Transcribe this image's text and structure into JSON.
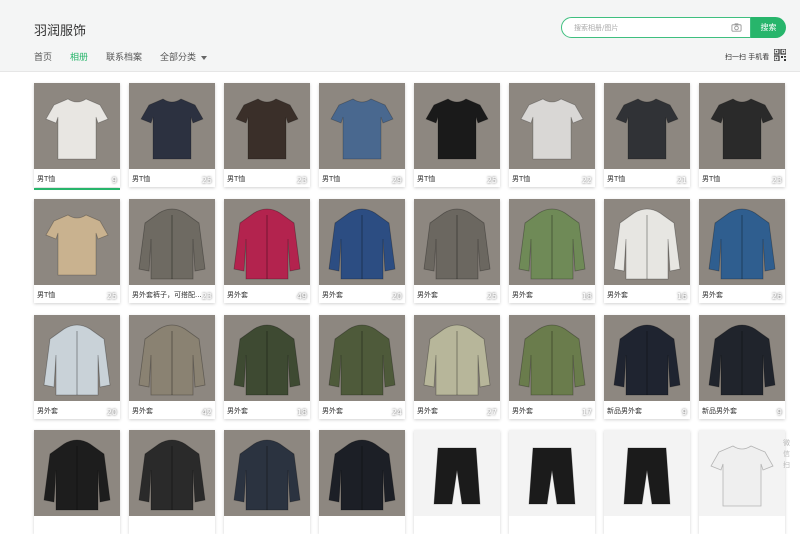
{
  "header": {
    "brand": "羽润服饰",
    "search_placeholder": "搜索相册/图片",
    "search_button": "搜索",
    "scan_text": "扫一扫 手机看"
  },
  "nav": {
    "items": [
      {
        "label": "首页"
      },
      {
        "label": "相册"
      },
      {
        "label": "联系档案"
      },
      {
        "label": "全部分类"
      }
    ]
  },
  "albums": [
    {
      "label": "男T恤",
      "count": "9",
      "tone": "#e8e6e2",
      "icon": "tshirt-photo"
    },
    {
      "label": "男T恤",
      "count": "25",
      "tone": "#2c3140",
      "icon": "tshirt-photo"
    },
    {
      "label": "男T恤",
      "count": "23",
      "tone": "#3a2f29",
      "icon": "tshirt-photo"
    },
    {
      "label": "男T恤",
      "count": "29",
      "tone": "#49688f",
      "icon": "tshirt-photo"
    },
    {
      "label": "男T恤",
      "count": "25",
      "tone": "#1a1a1a",
      "icon": "tshirt-photo"
    },
    {
      "label": "男T恤",
      "count": "22",
      "tone": "#d9d7d5",
      "icon": "tshirt-photo"
    },
    {
      "label": "男T恤",
      "count": "21",
      "tone": "#303236",
      "icon": "tshirt-photo"
    },
    {
      "label": "男T恤",
      "count": "23",
      "tone": "#2a2a2a",
      "icon": "tshirt-photo"
    },
    {
      "label": "男T恤",
      "count": "25",
      "tone": "#c9b28f",
      "icon": "tshirt-photo"
    },
    {
      "label": "男外套裤子，可搭配...",
      "count": "23",
      "tone": "#6e6a62",
      "icon": "jacket-photo"
    },
    {
      "label": "男外套",
      "count": "49",
      "tone": "#b3234e",
      "icon": "jacket-photo"
    },
    {
      "label": "男外套",
      "count": "20",
      "tone": "#2c4d82",
      "icon": "jacket-photo"
    },
    {
      "label": "男外套",
      "count": "25",
      "tone": "#6b6760",
      "icon": "jacket-photo"
    },
    {
      "label": "男外套",
      "count": "18",
      "tone": "#6f8a57",
      "icon": "jacket-photo"
    },
    {
      "label": "男外套",
      "count": "16",
      "tone": "#e7e6e2",
      "icon": "jacket-photo"
    },
    {
      "label": "男外套",
      "count": "26",
      "tone": "#2f5e8f",
      "icon": "jacket-photo"
    },
    {
      "label": "男外套",
      "count": "20",
      "tone": "#c9d2d8",
      "icon": "jacket-photo"
    },
    {
      "label": "男外套",
      "count": "42",
      "tone": "#8a8272",
      "icon": "jacket-photo"
    },
    {
      "label": "男外套",
      "count": "18",
      "tone": "#3e4a32",
      "icon": "jacket-photo"
    },
    {
      "label": "男外套",
      "count": "24",
      "tone": "#4e5a3a",
      "icon": "jacket-photo"
    },
    {
      "label": "男外套",
      "count": "27",
      "tone": "#b7b69a",
      "icon": "jacket-photo"
    },
    {
      "label": "男外套",
      "count": "17",
      "tone": "#6a7c4c",
      "icon": "jacket-photo"
    },
    {
      "label": "新品男外套",
      "count": "9",
      "tone": "#1f2430",
      "icon": "jacket-photo"
    },
    {
      "label": "新品男外套",
      "count": "9",
      "tone": "#20242c",
      "icon": "jacket-photo"
    },
    {
      "label": "",
      "count": "",
      "tone": "#1d1d1d",
      "icon": "jacket-photo"
    },
    {
      "label": "",
      "count": "",
      "tone": "#2a2a2a",
      "icon": "jacket-photo"
    },
    {
      "label": "",
      "count": "",
      "tone": "#2b3340",
      "icon": "jacket-photo"
    },
    {
      "label": "",
      "count": "",
      "tone": "#1c1f26",
      "icon": "jacket-photo"
    },
    {
      "label": "",
      "count": "",
      "tone": "#ffffff",
      "icon": "shorts-photo"
    },
    {
      "label": "",
      "count": "",
      "tone": "#ffffff",
      "icon": "shorts-photo"
    },
    {
      "label": "",
      "count": "",
      "tone": "#f4f4f4",
      "icon": "shorts-photo"
    },
    {
      "label": "",
      "count": "",
      "tone": "#efefef",
      "icon": "tshirt-photo"
    }
  ],
  "side_text": "微\n信\n扫"
}
